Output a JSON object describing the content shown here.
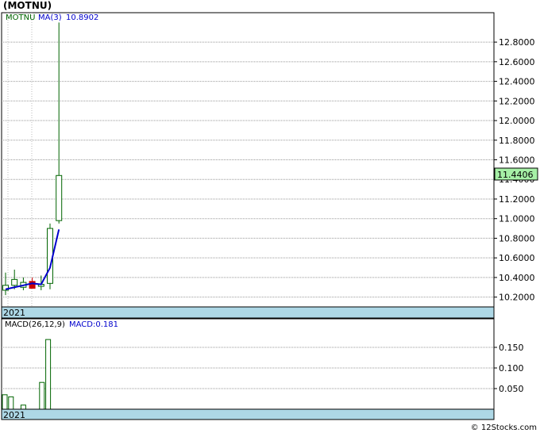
{
  "title": "(MOTNU)",
  "watermark": "© 12Stocks.com",
  "chart_data": [
    {
      "type": "candlestick",
      "ticker": "MOTNU",
      "ma_label": "MA(3)",
      "ma_value": "10.8902",
      "last_price_label": "11.4406",
      "last_price": 11.4406,
      "year_label": "2021",
      "ylim": [
        10.1,
        13.1
      ],
      "y_ticks": [
        "10.2000",
        "10.4000",
        "10.6000",
        "10.8000",
        "11.0000",
        "11.2000",
        "11.4000",
        "11.6000",
        "11.8000",
        "12.0000",
        "12.2000",
        "12.4000",
        "12.6000",
        "12.8000"
      ],
      "candles": [
        {
          "o": 10.27,
          "h": 10.45,
          "l": 10.22,
          "c": 10.32,
          "color": "up"
        },
        {
          "o": 10.32,
          "h": 10.48,
          "l": 10.28,
          "c": 10.38,
          "color": "up"
        },
        {
          "o": 10.3,
          "h": 10.4,
          "l": 10.27,
          "c": 10.35,
          "color": "up"
        },
        {
          "o": 10.36,
          "h": 10.4,
          "l": 10.29,
          "c": 10.29,
          "color": "down"
        },
        {
          "o": 10.31,
          "h": 10.42,
          "l": 10.27,
          "c": 10.33,
          "color": "up"
        },
        {
          "o": 10.34,
          "h": 10.95,
          "l": 10.28,
          "c": 10.9,
          "color": "up"
        },
        {
          "o": 10.98,
          "h": 13.0,
          "l": 10.95,
          "c": 11.44,
          "color": "up"
        }
      ],
      "ma": [
        10.28,
        10.3,
        10.32,
        10.34,
        10.33,
        10.5,
        10.89
      ],
      "colors": {
        "up": "#006400",
        "down": "#cc0000",
        "ma": "#0000cc",
        "band": "#aed8e6"
      }
    },
    {
      "type": "bar",
      "label": "MACD(26,12,9)",
      "value_label": "MACD:0.181",
      "year_label": "2021",
      "ylim": [
        0,
        0.2
      ],
      "y_ticks": [
        "0.050",
        "0.100",
        "0.150"
      ],
      "bars": [
        0.035,
        0.03,
        0.0,
        0.01,
        0.0,
        0.0,
        0.065,
        0.169
      ]
    }
  ]
}
